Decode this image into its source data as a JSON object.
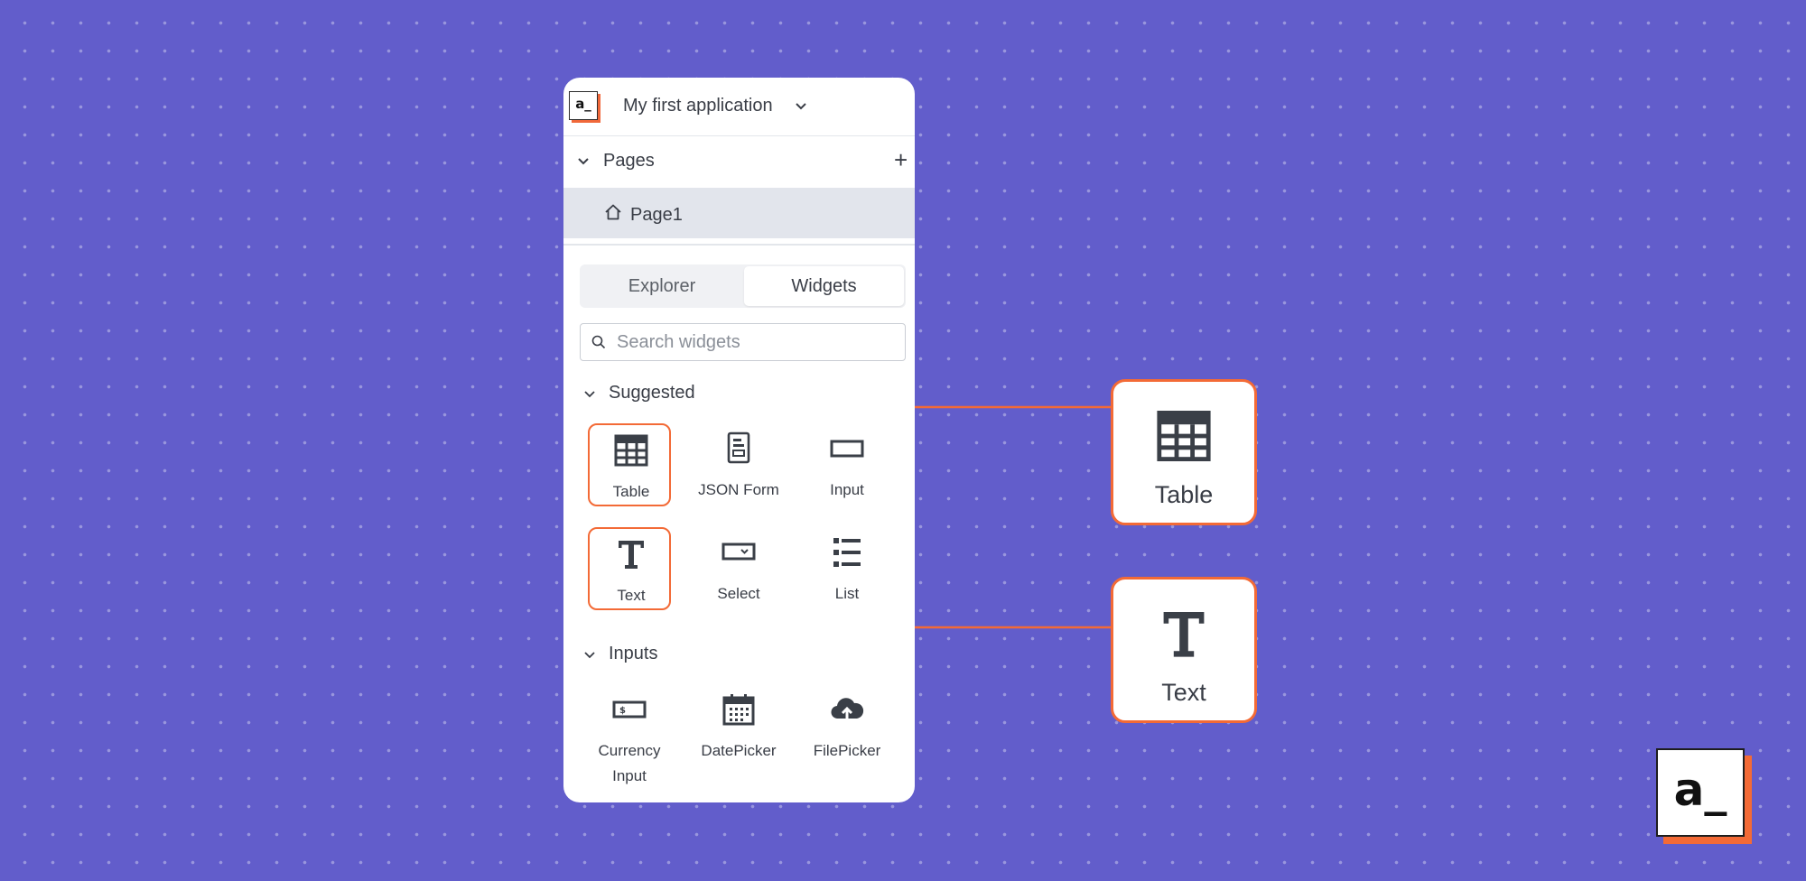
{
  "app": {
    "logo_text": "a_",
    "title": "My first application"
  },
  "pages": {
    "section_label": "Pages",
    "add_symbol": "+",
    "items": [
      {
        "label": "Page1"
      }
    ]
  },
  "tabs": [
    {
      "label": "Explorer",
      "active": false
    },
    {
      "label": "Widgets",
      "active": true
    }
  ],
  "search": {
    "placeholder": "Search widgets",
    "value": ""
  },
  "sections": {
    "suggested": {
      "label": "Suggested",
      "widgets": [
        {
          "label": "Table",
          "icon": "table-icon",
          "highlighted": true
        },
        {
          "label": "JSON Form",
          "icon": "json-form-icon",
          "highlighted": false
        },
        {
          "label": "Input",
          "icon": "input-icon",
          "highlighted": false
        },
        {
          "label": "Text",
          "icon": "text-icon",
          "highlighted": true
        },
        {
          "label": "Select",
          "icon": "select-icon",
          "highlighted": false
        },
        {
          "label": "List",
          "icon": "list-icon",
          "highlighted": false
        }
      ]
    },
    "inputs": {
      "label": "Inputs",
      "widgets": [
        {
          "label": "Currency\nInput",
          "line1": "Currency",
          "line2": "Input",
          "icon": "currency-input-icon"
        },
        {
          "label": "DatePicker",
          "icon": "calendar-icon"
        },
        {
          "label": "FilePicker",
          "icon": "cloud-upload-icon"
        }
      ]
    }
  },
  "callouts": [
    {
      "label": "Table",
      "icon": "table-icon"
    },
    {
      "label": "Text",
      "icon": "text-icon"
    }
  ],
  "brand_logo_text": "a_",
  "colors": {
    "background": "#625dcb",
    "accent": "#f36a36",
    "panel": "#ffffff",
    "selected_row": "#e2e5ec",
    "text": "#393d46"
  }
}
